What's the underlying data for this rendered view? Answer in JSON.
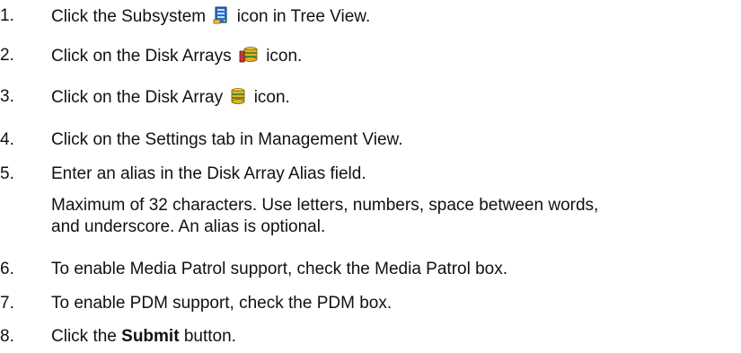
{
  "steps": [
    {
      "num": "1.",
      "before": "Click the Subsystem",
      "icon": "subsystem-icon",
      "after": "icon in Tree View."
    },
    {
      "num": "2.",
      "before": "Click on the Disk Arrays",
      "icon": "disk-arrays-icon",
      "after": "icon."
    },
    {
      "num": "3.",
      "before": "Click on the Disk Array",
      "icon": "disk-array-icon",
      "after": "icon."
    },
    {
      "num": "4.",
      "text": "Click on the Settings tab in Management View."
    },
    {
      "num": "5.",
      "text": "Enter an alias in the Disk Array Alias field."
    },
    {
      "num": "6.",
      "text": "To enable Media Patrol support, check the Media Patrol box."
    },
    {
      "num": "7.",
      "text": "To enable PDM support, check the PDM box."
    },
    {
      "num": "8.",
      "before": "Click the",
      "bold": "Submit",
      "after": "button."
    }
  ],
  "note": {
    "line1": "Maximum of 32 characters. Use letters, numbers, space between words,",
    "line2": "and underscore. An alias is optional."
  }
}
